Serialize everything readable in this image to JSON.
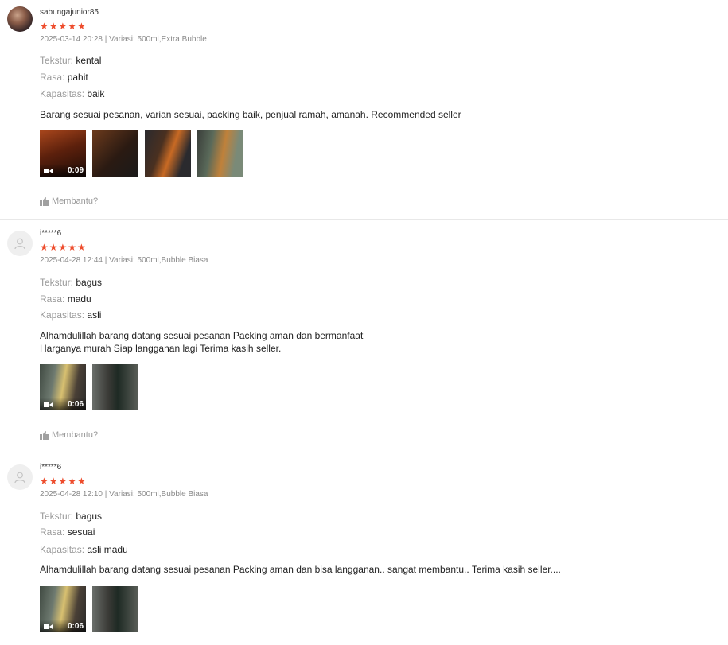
{
  "labels": {
    "tekstur": "Tekstur:",
    "rasa": "Rasa:",
    "kapasitas": "Kapasitas:",
    "helpful": "Membantu?",
    "stars": "★★★★★",
    "meta_sep": " | Variasi: "
  },
  "colors": {
    "star": "#ee4d2d",
    "muted": "#9a9a9a",
    "divider": "#e8e8e8"
  },
  "reviews": [
    {
      "username": "sabungajunior85",
      "avatar": "user-photo",
      "rating": 5,
      "date": "2025-03-14 20:28",
      "variation": "500ml,Extra Bubble",
      "tekstur": "kental",
      "rasa": "pahit",
      "kapasitas": "baik",
      "text_lines": [
        "Barang sesuai pesanan, varian sesuai, packing baik, penjual ramah, amanah. Recommended seller"
      ],
      "media": [
        {
          "type": "video",
          "duration": "0:09"
        },
        {
          "type": "image"
        },
        {
          "type": "image"
        },
        {
          "type": "image"
        }
      ]
    },
    {
      "username": "i*****6",
      "avatar": "default-user-icon",
      "rating": 5,
      "date": "2025-04-28 12:44",
      "variation": "500ml,Bubble Biasa",
      "tekstur": "bagus",
      "rasa": "madu",
      "kapasitas": "asli",
      "text_lines": [
        "Alhamdulillah barang datang sesuai pesanan Packing aman dan bermanfaat",
        "Harganya murah Siap langganan lagi Terima kasih seller."
      ],
      "media": [
        {
          "type": "video",
          "duration": "0:06"
        },
        {
          "type": "image"
        }
      ]
    },
    {
      "username": "i*****6",
      "avatar": "default-user-icon",
      "rating": 5,
      "date": "2025-04-28 12:10",
      "variation": "500ml,Bubble Biasa",
      "tekstur": "bagus",
      "rasa": "sesuai",
      "kapasitas": "asli madu",
      "text_lines": [
        "Alhamdulillah barang datang sesuai pesanan Packing aman dan bisa langganan.. sangat membantu.. Terima kasih seller...."
      ],
      "media": [
        {
          "type": "video",
          "duration": "0:06"
        },
        {
          "type": "image"
        }
      ]
    }
  ]
}
